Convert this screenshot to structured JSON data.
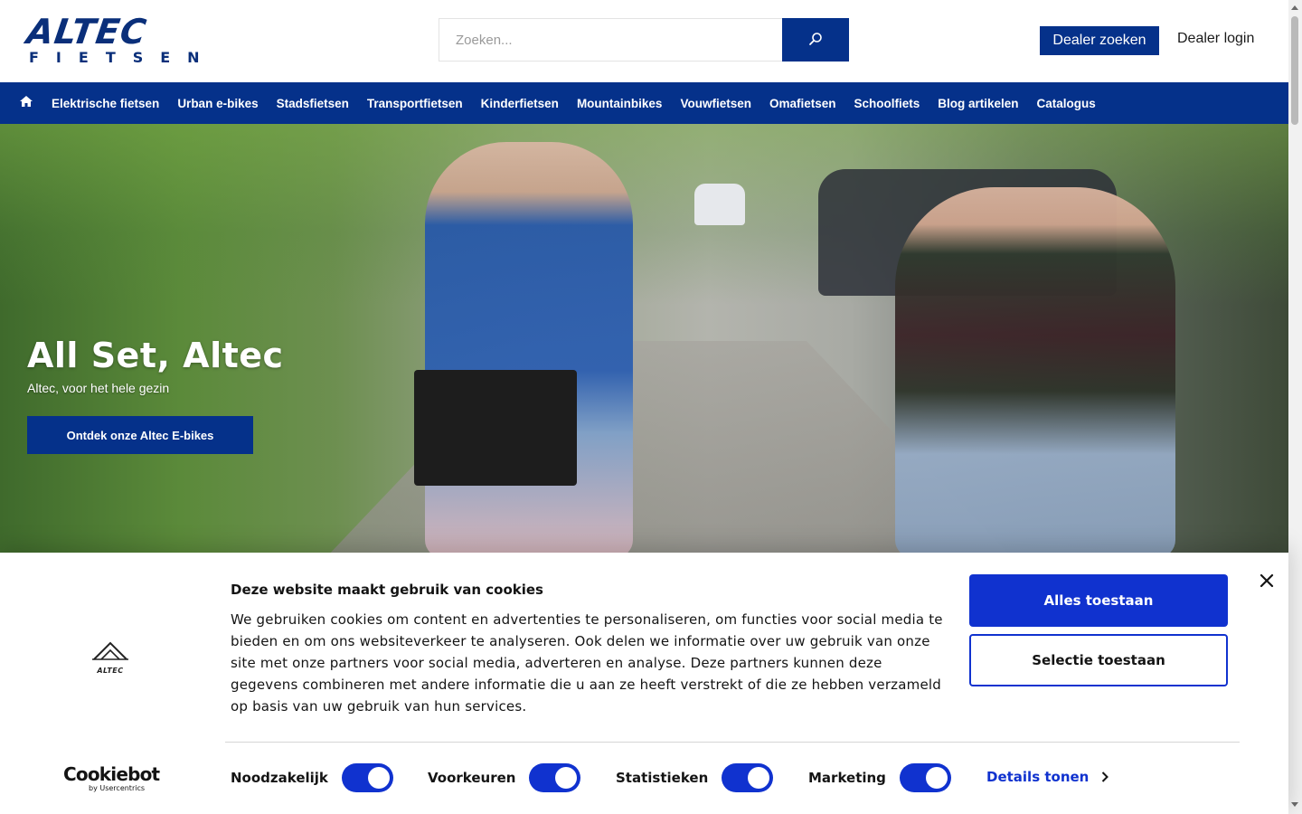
{
  "header": {
    "logo_main": "ALTEC",
    "logo_sub": "FIETSEN",
    "search_placeholder": "Zoeken...",
    "dealer_search_label": "Dealer zoeken",
    "dealer_login_label": "Dealer login"
  },
  "nav": {
    "items": [
      {
        "label": "Elektrische fietsen"
      },
      {
        "label": "Urban e-bikes"
      },
      {
        "label": "Stadsfietsen"
      },
      {
        "label": "Transportfietsen"
      },
      {
        "label": "Kinderfietsen"
      },
      {
        "label": "Mountainbikes"
      },
      {
        "label": "Vouwfietsen"
      },
      {
        "label": "Omafietsen"
      },
      {
        "label": "Schoolfiets"
      },
      {
        "label": "Blog artikelen"
      },
      {
        "label": "Catalogus"
      }
    ]
  },
  "hero": {
    "title": "All Set, Altec",
    "subtitle": "Altec, voor het hele gezin",
    "cta_label": "Ontdek onze Altec E-bikes"
  },
  "cookie": {
    "logo_text": "ALTEC",
    "title": "Deze website maakt gebruik van cookies",
    "text": "We gebruiken cookies om content en advertenties te personaliseren, om functies voor social media te bieden en om ons websiteverkeer te analyseren. Ook delen we informatie over uw gebruik van onze site met onze partners voor social media, adverteren en analyse. Deze partners kunnen deze gegevens combineren met andere informatie die u aan ze heeft verstrekt of die ze hebben verzameld op basis van uw gebruik van hun services.",
    "allow_all_label": "Alles toestaan",
    "allow_selection_label": "Selectie toestaan",
    "toggles": [
      {
        "label": "Noodzakelijk",
        "enabled": true
      },
      {
        "label": "Voorkeuren",
        "enabled": true
      },
      {
        "label": "Statistieken",
        "enabled": true
      },
      {
        "label": "Marketing",
        "enabled": true
      }
    ],
    "details_label": "Details tonen",
    "brand_name": "Cookiebot",
    "brand_by": "by Usercentrics"
  },
  "colors": {
    "brand_navy": "#05318a",
    "cookie_blue": "#1032cf"
  },
  "icons": {
    "home": "home-icon",
    "search": "search-icon",
    "close": "close-icon",
    "chevron": "chevron-right-icon"
  }
}
